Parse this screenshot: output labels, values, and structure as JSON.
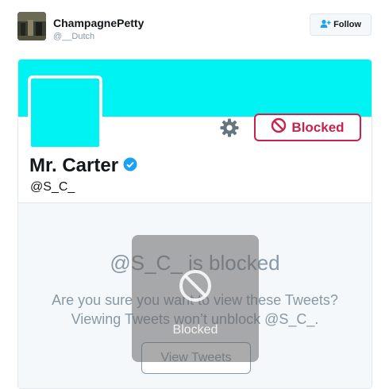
{
  "tweet_author": {
    "name": "ChampagnePetty",
    "handle": "@__Dutch",
    "follow_label": "Follow"
  },
  "profile": {
    "display_name": "Mr. Carter",
    "handle": "@S_C_",
    "verified": true,
    "blocked_label": "Blocked",
    "banner_color": "#00f3f3",
    "avatar_color": "#00f3f3",
    "blocked_color": "#c8224f"
  },
  "blocked_panel": {
    "title": "@S_C_ is blocked",
    "message_line1": "Are you sure you want to view these Tweets?",
    "message_line2": "Viewing Tweets won’t unblock @S_C_.",
    "view_button": "View Tweets"
  },
  "overlay": {
    "label": "Blocked",
    "icon": "blocked-icon"
  }
}
